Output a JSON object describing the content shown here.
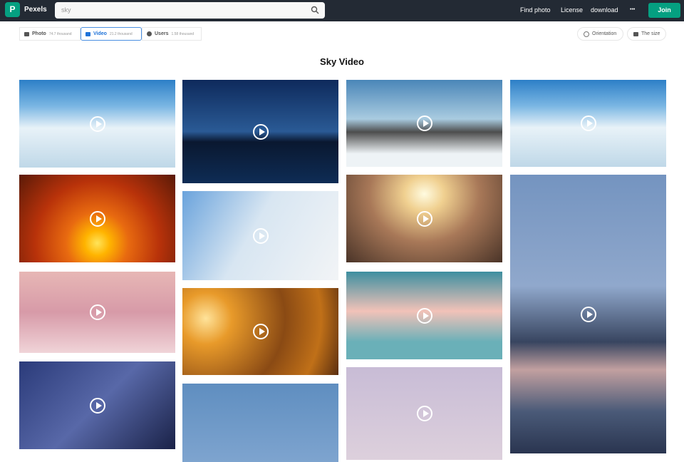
{
  "header": {
    "brand": "Pexels",
    "logo_letter": "P",
    "search_value": "sky",
    "nav": [
      "Find photo",
      "License",
      "download",
      "•••"
    ],
    "join": "Join"
  },
  "tabs": [
    {
      "label": "Photo",
      "count": "74.7 thousand"
    },
    {
      "label": "Video",
      "count": "21.2 thousand"
    },
    {
      "label": "Users",
      "count": "1.58 thousand"
    }
  ],
  "filters": {
    "orientation": "Orientation",
    "size": "The size"
  },
  "title": "Sky Video",
  "videos": [
    {
      "name": "clouds-above",
      "bg": "linear-gradient(#2d7fc7 0%,#7ab6e3 30%,#e8f2f8 55%,#bfd8e8 100%)"
    },
    {
      "name": "sunset-sun",
      "bg": "radial-gradient(circle at 50% 78%,#ffe45a 0,#ffb400 12%,#e86a10 30%,#b8320a 60%,#5a1a08 100%)"
    },
    {
      "name": "pink-clouds",
      "bg": "linear-gradient(#e7b7b5,#d79aa8 50%,#f0d4d8)"
    },
    {
      "name": "milky-way",
      "bg": "linear-gradient(135deg,#2b3b7a,#5868a8 50%,#1a2248)"
    },
    {
      "name": "lake-mountains",
      "bg": "linear-gradient(#0e2a5c 0%,#2a5a95 50%,#0a1830 60%,#0e2c55 100%)"
    },
    {
      "name": "blue-white-clouds",
      "bg": "linear-gradient(120deg,#6aa3dc,#d8e6f2 45%,#f2f4f6)"
    },
    {
      "name": "golden-clouds",
      "bg": "radial-gradient(circle at 15% 35%,#ffe39a 0,#e89a2a 18%,#8a4a14 55%,#c07018 80%,#5a2e10)"
    },
    {
      "name": "flower-branch",
      "bg": "linear-gradient(#5f8ec0,#7ea4cf)"
    },
    {
      "name": "mountain-peak",
      "bg": "linear-gradient(#4a86b8,#a9cbe0 45%,#4d4d4d 60%,#eef3f6 85%)"
    },
    {
      "name": "sun-haze",
      "bg": "radial-gradient(ellipse at 50% 22%,#fffbe0 0,#f0d090 18%,#a87858 50%,#4a3428 100%)"
    },
    {
      "name": "teal-clouds",
      "bg": "linear-gradient(#3d8fa0,#f2c2b8 45%,#6ab0b8 80%)"
    },
    {
      "name": "lavender-sky",
      "bg": "linear-gradient(#c8bcd6,#ddd0dc)"
    },
    {
      "name": "clouds-above-2",
      "bg": "linear-gradient(#2d7fc7 0%,#7ab6e3 30%,#e8f2f8 55%,#bfd8e8 100%)"
    },
    {
      "name": "dark-clouds",
      "bg": "linear-gradient(#7494c0,#90a8cc 40%,#384560 60%,#c2a0a0 70%,#4a5a78 85%,#2a3550)"
    }
  ]
}
